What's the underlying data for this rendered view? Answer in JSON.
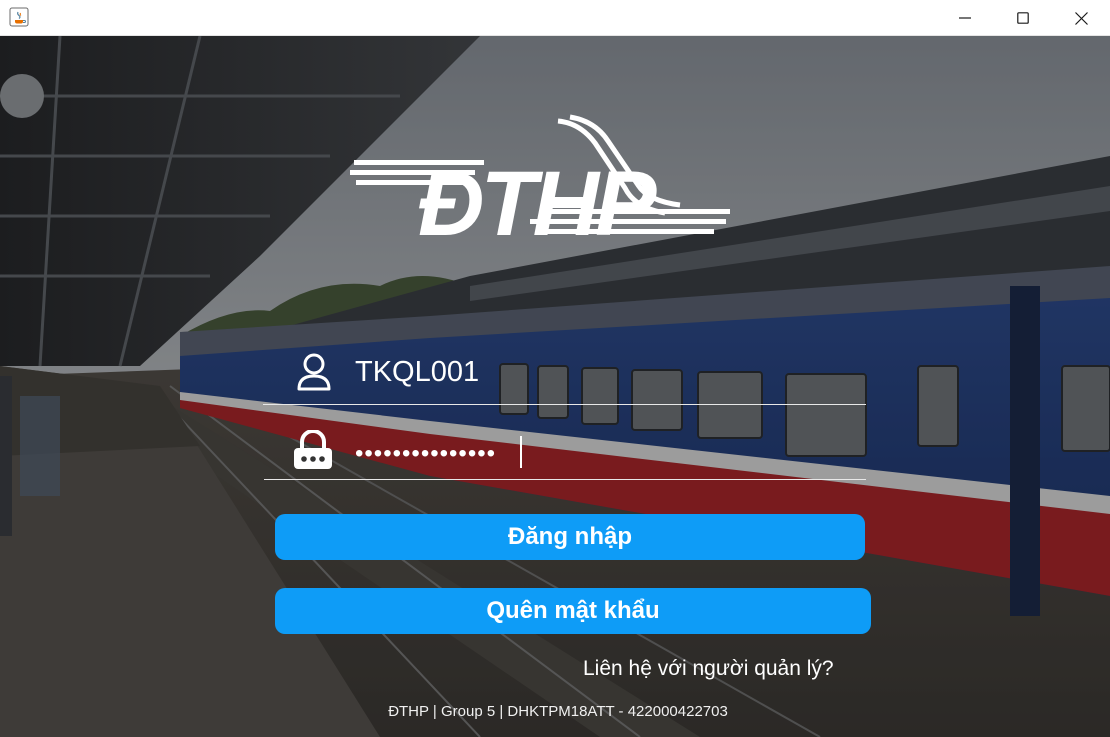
{
  "window": {
    "controls": {
      "minimize": "minimize-icon",
      "maximize": "maximize-icon",
      "close": "close-icon"
    }
  },
  "logo": {
    "text": "ĐTHP"
  },
  "form": {
    "username": {
      "value": "TKQL001"
    },
    "password": {
      "value": "•••••••••••••••"
    }
  },
  "buttons": {
    "login": "Đăng nhập",
    "forgot": "Quên mật khẩu"
  },
  "contact_link": "Liên hệ với người quản lý?",
  "footer": "ĐTHP | Group 5 | DHKTPM18ATT - 422000422703",
  "colors": {
    "accent": "#0e9cf7",
    "text": "#ffffff"
  }
}
